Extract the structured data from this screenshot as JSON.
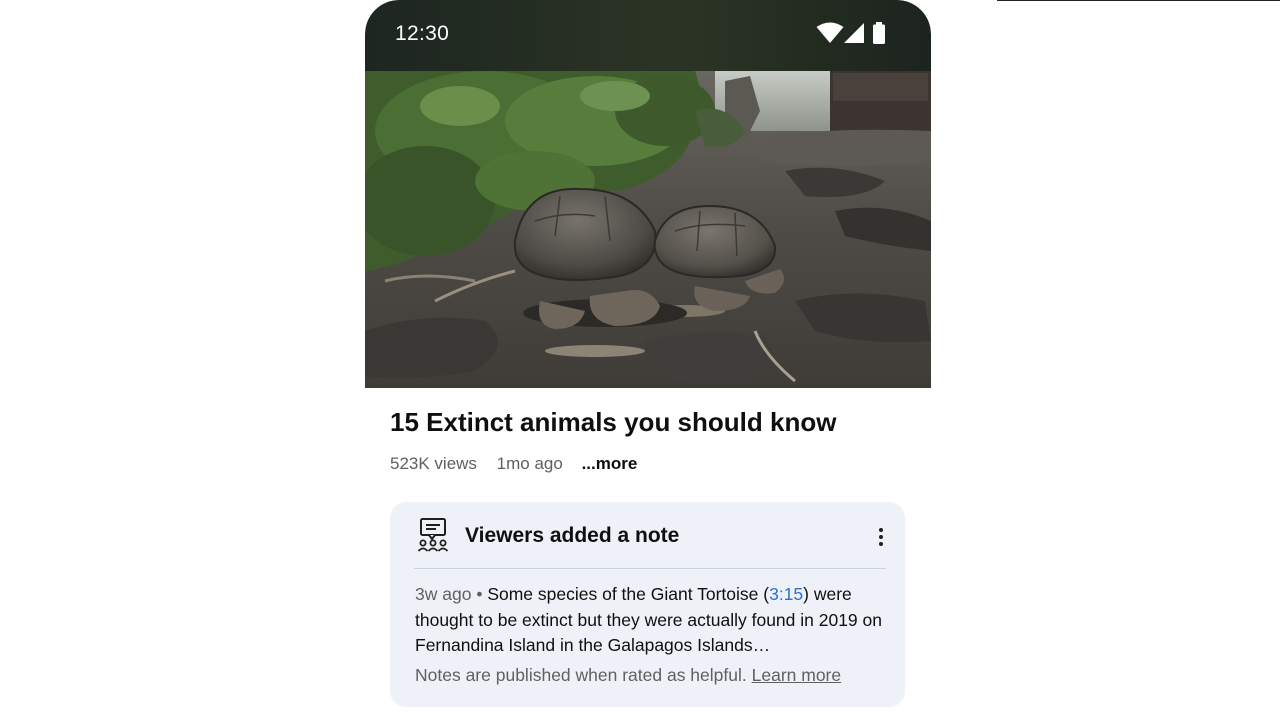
{
  "status_bar": {
    "time": "12:30",
    "icons": [
      "wifi-icon",
      "cellular-signal-icon",
      "battery-icon"
    ]
  },
  "video": {
    "thumbnail_icon": "tortoise-photo",
    "title": "15 Extinct animals you should know",
    "views": "523K views",
    "age": "1mo ago",
    "more_label": "...more"
  },
  "note": {
    "icon": "viewers-note-icon",
    "heading": "Viewers added a note",
    "menu_icon": "more-vert-icon",
    "age": "3w ago",
    "separator": "•",
    "text_before_timestamp": "Some species of the Giant Tortoise (",
    "timestamp": "3:15",
    "text_after_timestamp": ") were thought to be extinct but they were actually found in 2019 on Fernandina Island in the Galapagos Islands…",
    "footer_text": "Notes are published when rated as helpful.",
    "learn_more": "Learn more"
  },
  "colors": {
    "status_bar_bg": "#252e22",
    "card_bg": "#eef2f8",
    "link_blue": "#2d6fd1",
    "secondary_text": "#606060"
  }
}
